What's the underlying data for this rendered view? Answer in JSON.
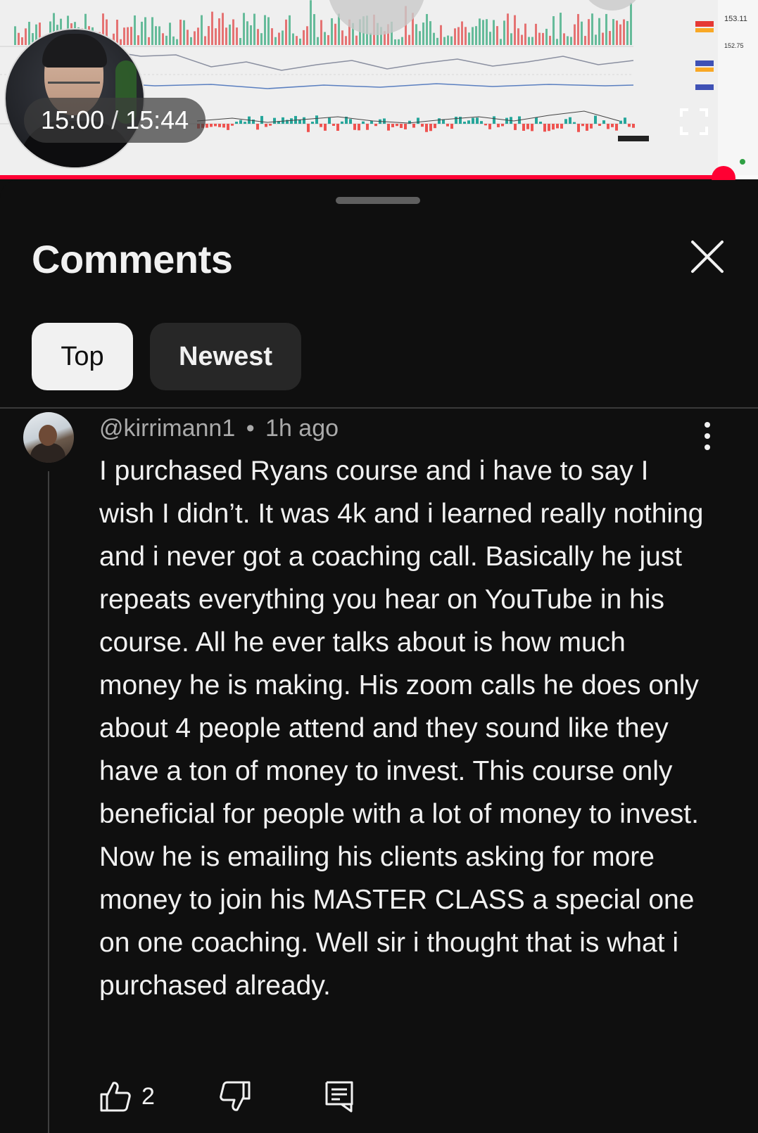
{
  "player": {
    "current_time": "15:00",
    "separator": " / ",
    "duration": "15:44",
    "progress_fraction": 0.953,
    "accent_color": "#ff0033",
    "background_chart": {
      "price_labels": [
        "153.11",
        "152.75"
      ]
    }
  },
  "comments_panel": {
    "title": "Comments",
    "close_icon": "close-icon",
    "sort_chips": [
      {
        "label": "Top",
        "selected": true
      },
      {
        "label": "Newest",
        "selected": false
      }
    ]
  },
  "comment": {
    "author": "@kirrimann1",
    "dot": "•",
    "time_ago": "1h ago",
    "text": "I purchased Ryans course and i have to say I wish I didn’t. It was 4k and i learned really nothing and i never got a coaching call. Basically he just repeats everything you hear on YouTube in his course. All he ever talks about is how much money he is making. His zoom calls he does only about 4 people attend and they sound like they have a ton of money to invest. This course only beneficial for people with a lot of money to invest. Now he is emailing his clients asking for more money to join his MASTER CLASS a special one on one coaching. Well sir i thought that is what i purchased already.",
    "like_count": "2",
    "icons": [
      "thumbs-up-icon",
      "thumbs-down-icon",
      "reply-icon",
      "more-vert-icon"
    ]
  }
}
